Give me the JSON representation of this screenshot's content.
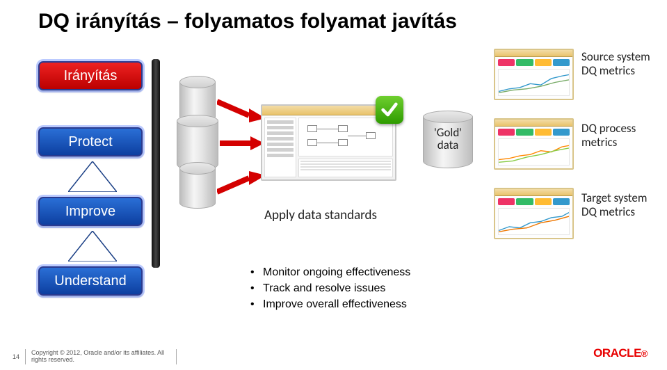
{
  "title": {
    "main": "DQ irányítás",
    "sub": "– folyamatos folyamat javítás"
  },
  "stages": {
    "iranyitas": "Irányítás",
    "protect": "Protect",
    "improve": "Improve",
    "understand": "Understand"
  },
  "flow": {
    "gold_line1": "'Gold'",
    "gold_line2": "data",
    "apply_label": "Apply data standards"
  },
  "right_labels": {
    "source": "Source system DQ metrics",
    "process": "DQ process metrics",
    "target": "Target system DQ metrics"
  },
  "bullets": [
    "Monitor ongoing effectiveness",
    "Track and resolve issues",
    "Improve overall effectiveness"
  ],
  "footer": {
    "page": "14",
    "copyright": "Copyright © 2012, Oracle and/or its affiliates. All rights reserved."
  },
  "logo": {
    "text": "ORACLE",
    "color": "#e80000"
  },
  "colors": {
    "red_stage": "#c51111",
    "blue_stage": "#0d3fa0",
    "check_green": "#3aa70c"
  }
}
